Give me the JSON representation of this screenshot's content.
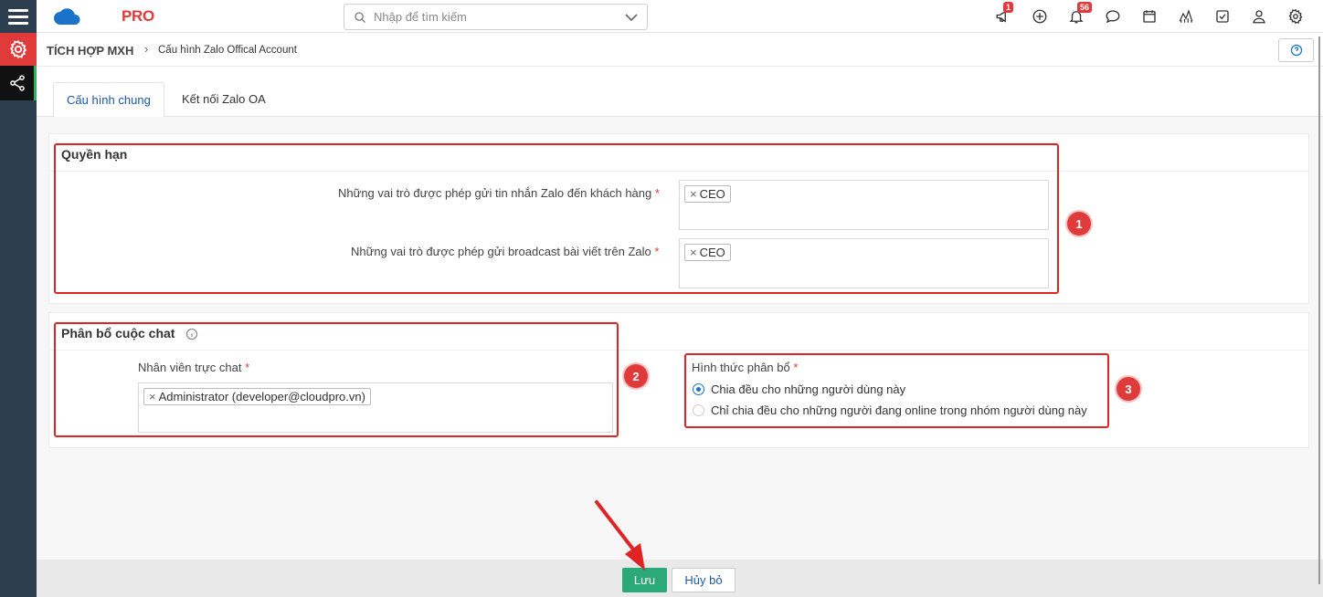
{
  "app": {
    "logo_main": "CLOUD",
    "logo_accent": "PRO"
  },
  "search": {
    "placeholder": "Nhập để tìm kiếm"
  },
  "topbar": {
    "announcements_badge": "1",
    "notifications_badge": "56"
  },
  "breadcrumb": {
    "section": "TÍCH HỢP MXH",
    "page": "Cấu hình Zalo Offical Account"
  },
  "tabs": [
    {
      "label": "Cấu hình chung",
      "active": true
    },
    {
      "label": "Kết nối Zalo OA",
      "active": false
    }
  ],
  "permissions": {
    "title": "Quyền hạn",
    "send_message_label": "Những vai trò được phép gửi tin nhắn Zalo đến khách hàng",
    "send_message_tags": [
      "CEO"
    ],
    "broadcast_label": "Những vai trò được phép gửi broadcast bài viết trên Zalo",
    "broadcast_tags": [
      "CEO"
    ],
    "required_mark": "*",
    "tag_remove": "×"
  },
  "chat_distribution": {
    "title": "Phân bổ cuộc chat",
    "agents_label": "Nhân viên trực chat",
    "agents_tags": [
      "Administrator (developer@cloudpro.vn)"
    ],
    "method_label": "Hình thức phân bổ",
    "options": [
      {
        "label": "Chia đều cho những người dùng này",
        "selected": true
      },
      {
        "label": "Chỉ chia đều cho những người đang online trong nhóm người dùng này",
        "selected": false
      }
    ]
  },
  "annotations": [
    "1",
    "2",
    "3"
  ],
  "footer": {
    "save_label": "Lưu",
    "cancel_label": "Hủy bỏ"
  },
  "colors": {
    "accent": "#1a73c9",
    "danger": "#e03b3b",
    "save": "#2ca978",
    "rail": "#2c3e50"
  }
}
